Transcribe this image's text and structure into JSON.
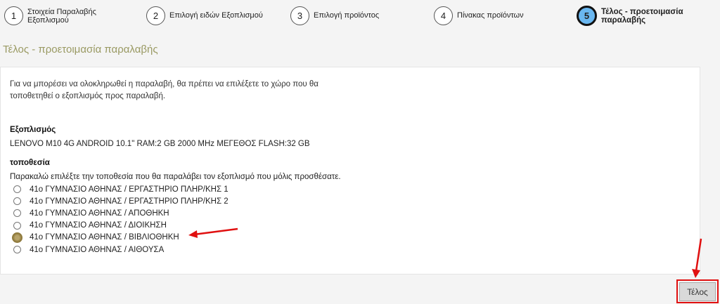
{
  "stepper": {
    "steps": [
      {
        "number": "1",
        "label_line1": "Στοιχεία Παραλαβής",
        "label_line2": "Εξοπλισμού"
      },
      {
        "number": "2",
        "label_line1": "Επιλογή ειδών Εξοπλισμού",
        "label_line2": ""
      },
      {
        "number": "3",
        "label_line1": "Επιλογή προϊόντος",
        "label_line2": ""
      },
      {
        "number": "4",
        "label_line1": "Πίνακας προϊόντων",
        "label_line2": ""
      },
      {
        "number": "5",
        "label_line1": "Τέλος - προετοιμασία",
        "label_line2": "παραλαβής"
      }
    ],
    "active_step": "5"
  },
  "page_title": "Τέλος - προετοιμασία παραλαβής",
  "intro": "Για να μπορέσει να ολοκληρωθεί η παραλαβή, θα πρέπει να επιλέξετε το χώρο που θα τοποθετηθεί ο εξοπλισμός προς παραλαβή.",
  "equipment": {
    "heading": "Εξοπλισμός",
    "value": "LENOVO M10 4G ANDROID 10.1\" RAM:2 GB 2000 MHz ΜΕΓΕΘΟΣ FLASH:32 GB"
  },
  "location": {
    "heading": "τοποθεσία",
    "instruction": "Παρακαλώ επιλέξτε την τοποθεσία που θα παραλάβει τον εξοπλισμό που μόλις προσθέσατε.",
    "options": [
      "41ο ΓΥΜΝΑΣΙΟ ΑΘΗΝΑΣ / ΕΡΓΑΣΤΗΡΙΟ ΠΛΗΡ/ΚΗΣ 1",
      "41ο ΓΥΜΝΑΣΙΟ ΑΘΗΝΑΣ / ΕΡΓΑΣΤΗΡΙΟ ΠΛΗΡ/ΚΗΣ 2",
      "41ο ΓΥΜΝΑΣΙΟ ΑΘΗΝΑΣ / ΑΠΟΘΗΚΗ",
      "41ο ΓΥΜΝΑΣΙΟ ΑΘΗΝΑΣ / ΔΙΟΙΚΗΣΗ",
      "41ο ΓΥΜΝΑΣΙΟ ΑΘΗΝΑΣ / ΒΙΒΛΙΟΘΗΚΗ",
      "41ο ΓΥΜΝΑΣΙΟ ΑΘΗΝΑΣ / ΑΙΘΟΥΣΑ"
    ],
    "selected_index": 4
  },
  "finish_button": "Τέλος",
  "colors": {
    "title": "#9a9a63",
    "active_step": "#6ab7f0",
    "annotation_red": "#e01010"
  }
}
